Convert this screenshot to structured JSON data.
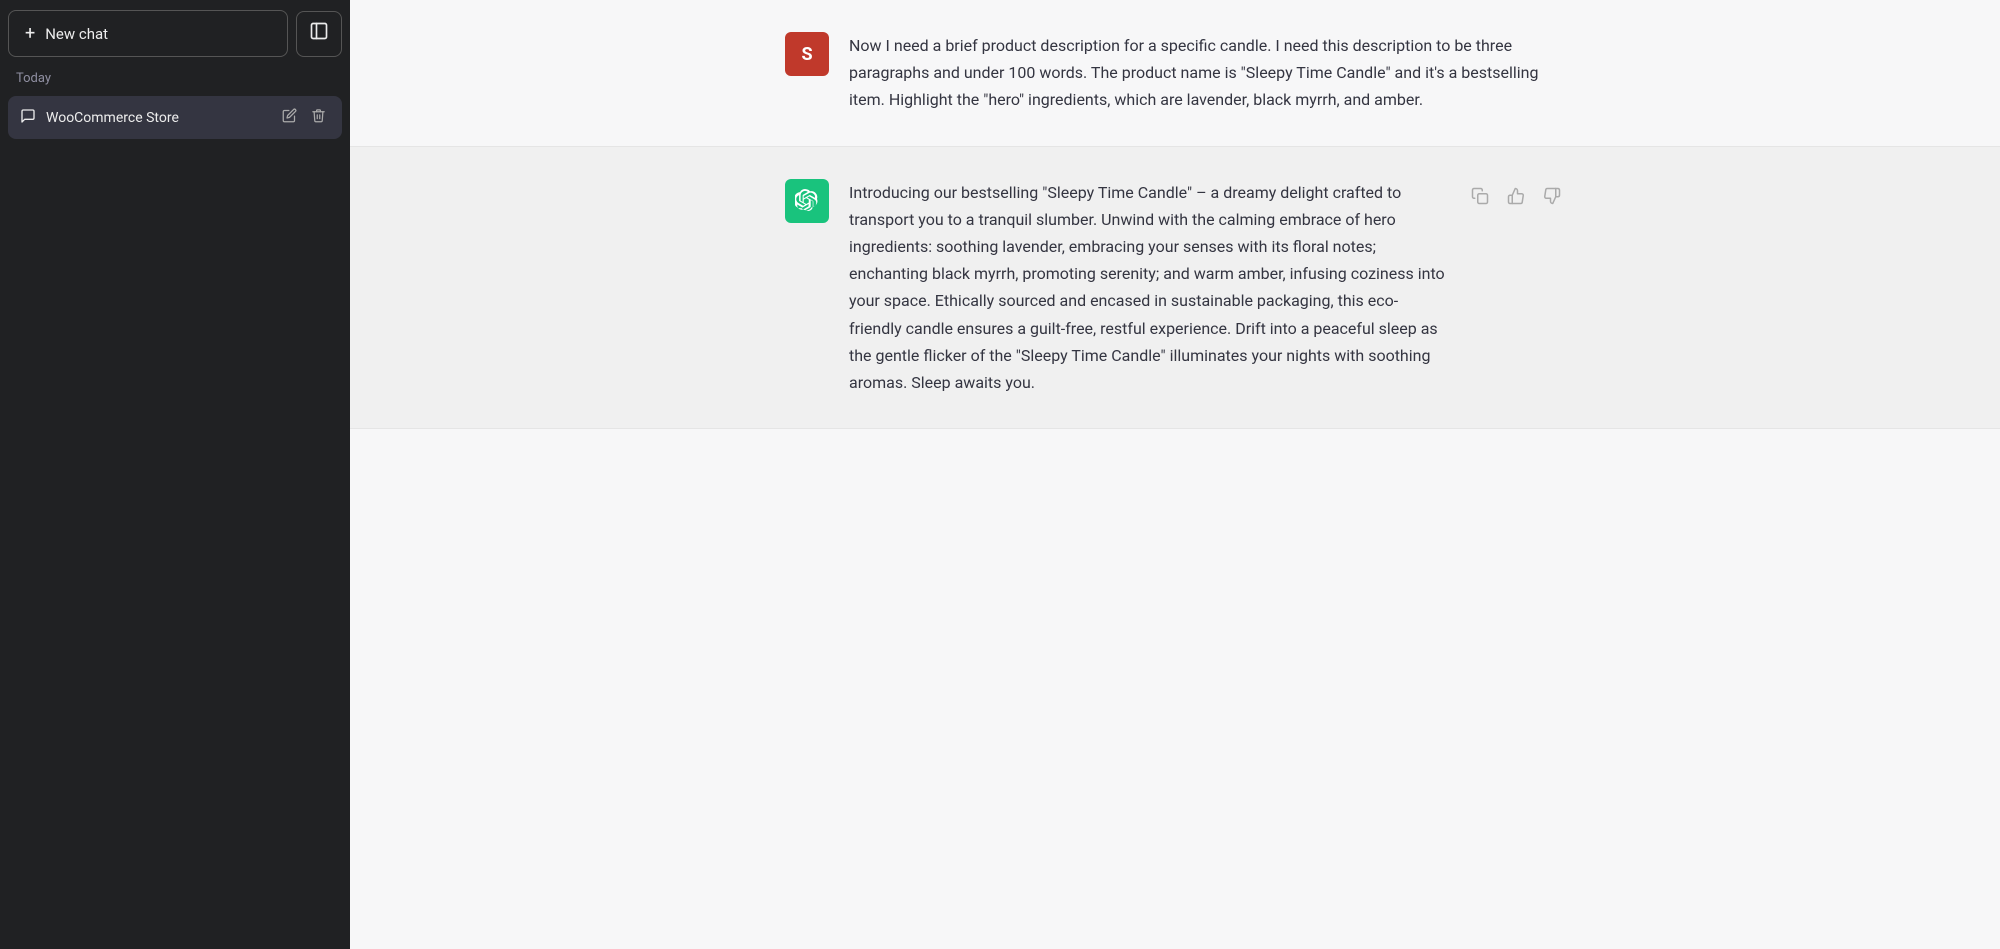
{
  "sidebar": {
    "new_chat_label": "New chat",
    "toggle_icon": "⊟",
    "plus_icon": "+",
    "section_today": "Today",
    "chat_icon": "💬",
    "chat_label": "WooCommerce Store",
    "edit_icon": "✏",
    "delete_icon": "🗑"
  },
  "messages": [
    {
      "id": "msg-user",
      "type": "user",
      "avatar_letter": "S",
      "text": "Now I need a brief product description for a specific candle. I need this description to be three paragraphs and under 100 words. The product name is \"Sleepy Time Candle\" and it's a bestselling item. Highlight the \"hero\" ingredients, which are lavender, black myrrh, and amber."
    },
    {
      "id": "msg-ai",
      "type": "ai",
      "avatar_symbol": "✦",
      "text": "Introducing our bestselling \"Sleepy Time Candle\" – a dreamy delight crafted to transport you to a tranquil slumber. Unwind with the calming embrace of hero ingredients: soothing lavender, embracing your senses with its floral notes; enchanting black myrrh, promoting serenity; and warm amber, infusing coziness into your space. Ethically sourced and encased in sustainable packaging, this eco-friendly candle ensures a guilt-free, restful experience. Drift into a peaceful sleep as the gentle flicker of the \"Sleepy Time Candle\" illuminates your nights with soothing aromas. Sleep awaits you.",
      "actions": {
        "copy_icon": "⧉",
        "thumbs_up_icon": "👍",
        "thumbs_down_icon": "👎"
      }
    }
  ],
  "colors": {
    "user_avatar_bg": "#c0392b",
    "ai_avatar_bg": "#19c37d",
    "sidebar_bg": "#202123",
    "chat_item_bg": "#343541",
    "main_bg": "#f7f7f8",
    "ai_block_bg": "#f0f0f0"
  }
}
